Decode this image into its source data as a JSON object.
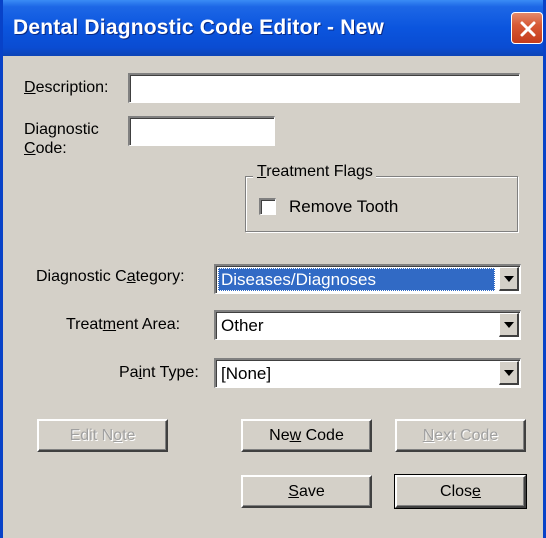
{
  "window": {
    "title": "Dental Diagnostic Code Editor - New",
    "close_icon": "close-icon"
  },
  "form": {
    "description": {
      "label_accel": "D",
      "label_rest": "escription:",
      "value": ""
    },
    "diagnostic_code": {
      "label_line1": "Diagnostic",
      "label_accel": "C",
      "label_rest": "ode:",
      "value": ""
    },
    "treatment_flags": {
      "legend_accel": "T",
      "legend_rest": "reatment Flags",
      "remove_tooth": {
        "label": "Remove Tooth",
        "checked": false
      }
    },
    "diagnostic_category": {
      "label_pre": "Diagnostic C",
      "label_accel": "a",
      "label_post": "tegory:",
      "value": "Diseases/Diagnoses"
    },
    "treatment_area": {
      "label_pre": "Treat",
      "label_accel": "m",
      "label_post": "ent Area:",
      "value": "Other"
    },
    "paint_type": {
      "label_pre": "Pa",
      "label_accel": "i",
      "label_post": "nt Type:",
      "value": "[None]"
    }
  },
  "buttons": {
    "edit_note": {
      "pre": "Edit N",
      "accel": "o",
      "post": "te",
      "enabled": false
    },
    "new_code": {
      "pre": "Ne",
      "accel": "w",
      "post": " Code",
      "enabled": true
    },
    "next_code": {
      "pre": "",
      "accel": "N",
      "post": "ext Code",
      "enabled": false
    },
    "save": {
      "pre": "",
      "accel": "S",
      "post": "ave",
      "enabled": true
    },
    "close": {
      "pre": "Clos",
      "accel": "e",
      "post": "",
      "enabled": true
    }
  },
  "colors": {
    "titlebar": "#0b55de",
    "dialog_bg": "#d4d0c8",
    "selection": "#316ac5",
    "close_button": "#d85a36"
  }
}
